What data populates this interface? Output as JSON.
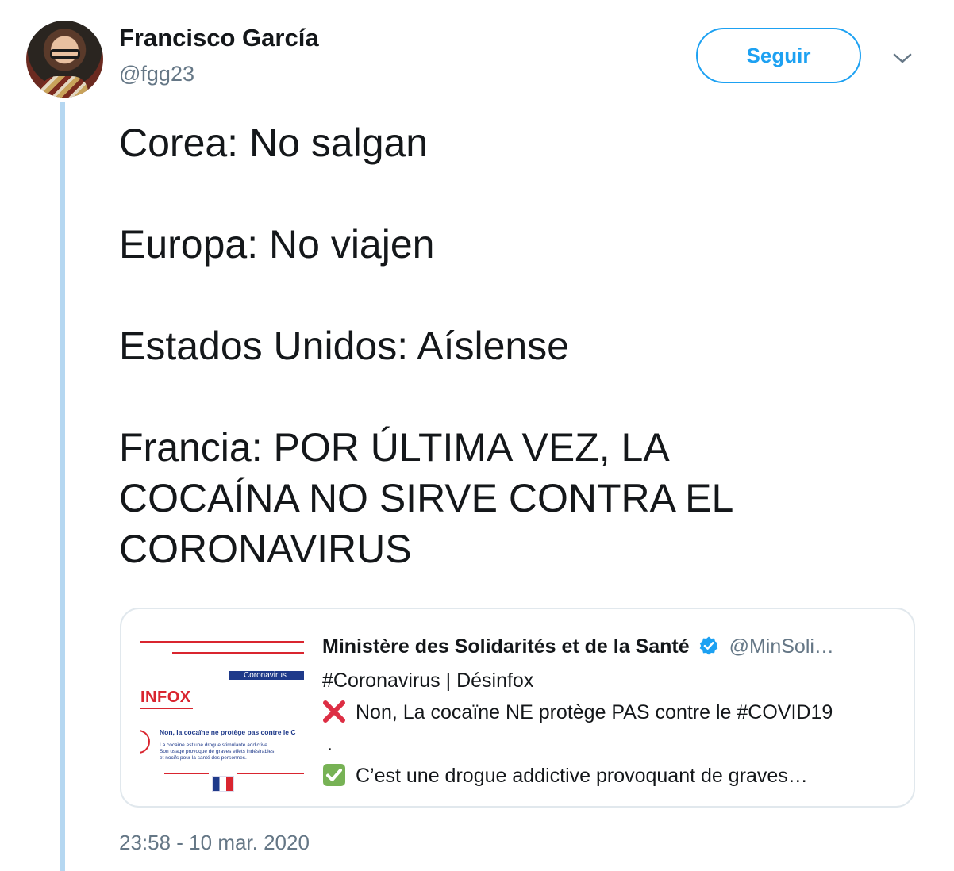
{
  "author": {
    "name": "Francisco García",
    "handle": "@fgg23",
    "avatar_icon": "user-avatar-photo"
  },
  "follow_button": {
    "label": "Seguir"
  },
  "menu_icon": "chevron-down-icon",
  "tweet": {
    "lines": [
      "Corea: No salgan",
      "Europa: No viajen",
      "Estados Unidos: Aíslense",
      "Francia: POR ÚLTIMA VEZ, LA",
      "COCAÍNA NO SIRVE CONTRA EL",
      "CORONAVIRUS"
    ],
    "timestamp": "23:58 - 10 mar. 2020"
  },
  "quoted_tweet": {
    "author_name": "Ministère des Solidarités et de la Santé",
    "author_handle": "@MinSoli…",
    "verified": true,
    "line1": "#Coronavirus | Désinfox",
    "line2": "Non, La cocaïne NE protège PAS contre le #COVID19",
    "line3": ".",
    "line4": "C’est une drogue addictive provoquant de graves…",
    "thumbnail": {
      "banner": "Coronavirus",
      "title": "INFOX",
      "headline": "Non, la cocaïne ne protège pas contre le C",
      "body_1": "La cocaïne est une drogue stimulante addictive.",
      "body_2": "Son usage provoque de graves effets indésirables",
      "body_3": "et nocifs pour la santé des personnes."
    }
  },
  "colors": {
    "accent": "#1da1f2",
    "thread_line": "#b5d7f1",
    "secondary_text": "#657786",
    "card_border": "#e1e8ed"
  }
}
